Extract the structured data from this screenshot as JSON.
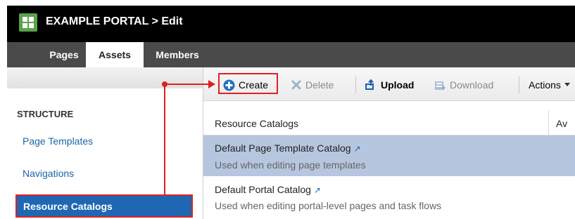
{
  "header": {
    "title": "EXAMPLE PORTAL > Edit",
    "logo_icon": "portal-grid-icon"
  },
  "tabs": [
    {
      "label": "Pages",
      "active": false
    },
    {
      "label": "Assets",
      "active": true
    },
    {
      "label": "Members",
      "active": false
    }
  ],
  "toolbar": {
    "create": {
      "label": "Create",
      "icon": "plus-circle-icon",
      "enabled": true
    },
    "delete": {
      "label": "Delete",
      "icon": "x-icon",
      "enabled": false
    },
    "upload": {
      "label": "Upload",
      "icon": "upload-icon",
      "enabled": true
    },
    "download": {
      "label": "Download",
      "icon": "download-icon",
      "enabled": false
    },
    "actions": {
      "label": "Actions"
    }
  },
  "sidebar": {
    "heading": "STRUCTURE",
    "items": [
      {
        "label": "Page Templates",
        "selected": false
      },
      {
        "label": "Navigations",
        "selected": false
      },
      {
        "label": "Resource Catalogs",
        "selected": true
      }
    ]
  },
  "table": {
    "columns": [
      "Resource Catalogs",
      "Av"
    ],
    "rows": [
      {
        "title": "Default Page Template Catalog",
        "description": "Used when editing page templates",
        "selected": true
      },
      {
        "title": "Default Portal Catalog",
        "description": "Used when editing portal-level pages and task flows",
        "selected": false
      }
    ]
  },
  "colors": {
    "accent_blue": "#2067b3",
    "annotation_red": "#e02020",
    "selected_row": "#b6c6df",
    "tab_bar": "#4a4a4a",
    "logo_green": "#5aa34a"
  }
}
